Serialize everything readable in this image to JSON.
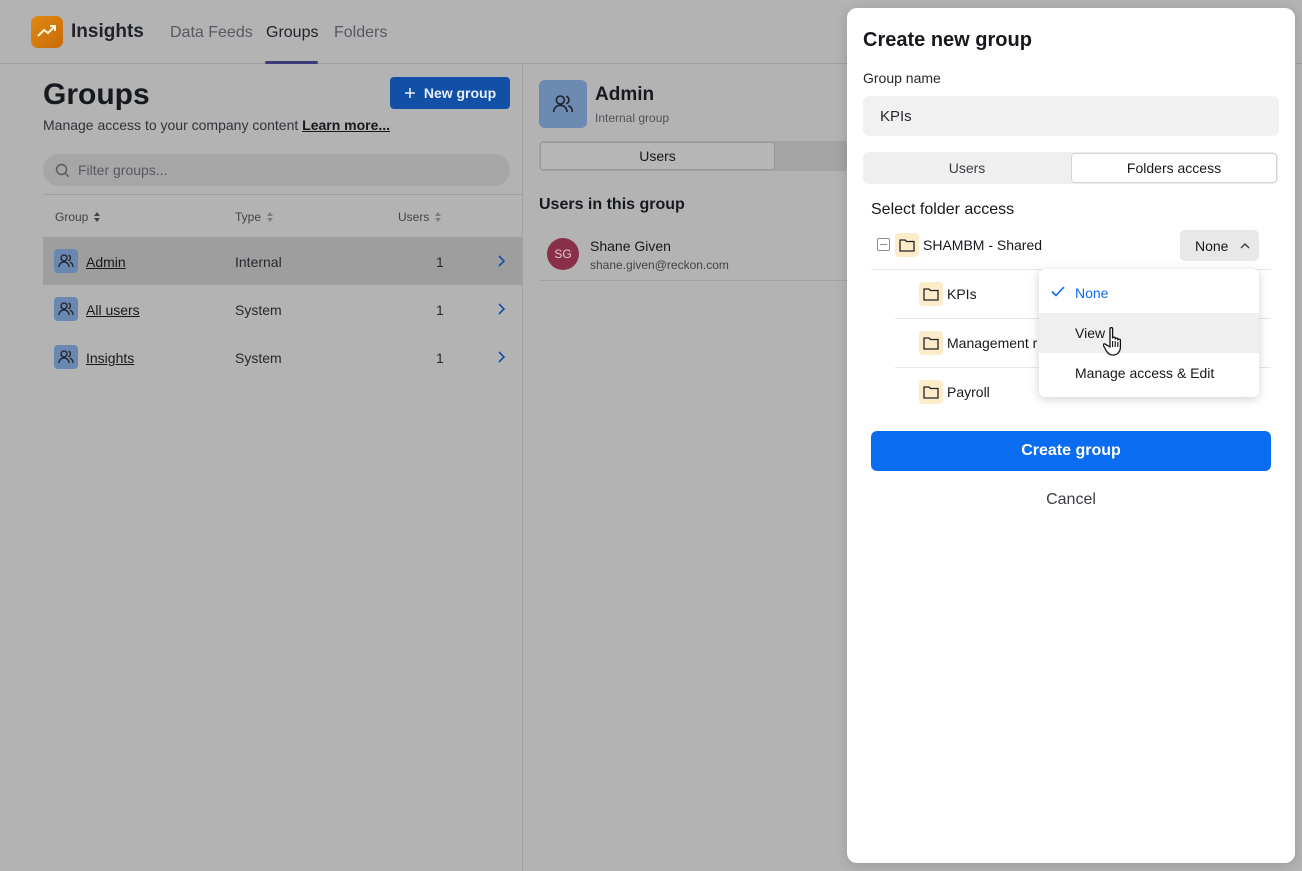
{
  "app": {
    "brand": "Insights",
    "nav": [
      {
        "label": "Data Feeds"
      },
      {
        "label": "Groups"
      },
      {
        "label": "Folders"
      }
    ]
  },
  "groups_page": {
    "title": "Groups",
    "subtitle": "Manage access to your company content",
    "learn_more": "Learn more...",
    "new_group_label": "New group",
    "filter_placeholder": "Filter groups...",
    "columns": [
      "Group",
      "Type",
      "Users"
    ],
    "rows": [
      {
        "name": "Admin",
        "type": "Internal",
        "users": "1",
        "selected": true
      },
      {
        "name": "All users",
        "type": "System",
        "users": "1",
        "selected": false
      },
      {
        "name": "Insights",
        "type": "System",
        "users": "1",
        "selected": false
      }
    ]
  },
  "detail": {
    "title": "Admin",
    "subtitle": "Internal group",
    "tab_users": "Users",
    "users_heading": "Users in this group",
    "user": {
      "initials": "SG",
      "name": "Shane Given",
      "email": "shane.given@reckon.com"
    }
  },
  "modal": {
    "title": "Create new group",
    "group_name_label": "Group name",
    "group_name_value": "KPIs",
    "tabs": [
      "Users",
      "Folders access"
    ],
    "active_tab": "Folders access",
    "select_folder_heading": "Select folder access",
    "root_folder": {
      "name": "SHAMBM - Shared",
      "access": "None"
    },
    "subfolders": [
      {
        "name": "KPIs"
      },
      {
        "name": "Management r"
      },
      {
        "name": "Payroll"
      }
    ],
    "access_menu": {
      "options": [
        "None",
        "View",
        "Manage access & Edit"
      ],
      "selected": "None",
      "hovered": "View"
    },
    "create_label": "Create group",
    "cancel_label": "Cancel"
  },
  "colors": {
    "accent": "#0a6cf0",
    "brand_orange": "#e08a12",
    "overlay_gray": "#b3b3b3",
    "folder_bg": "#fdecc9"
  }
}
